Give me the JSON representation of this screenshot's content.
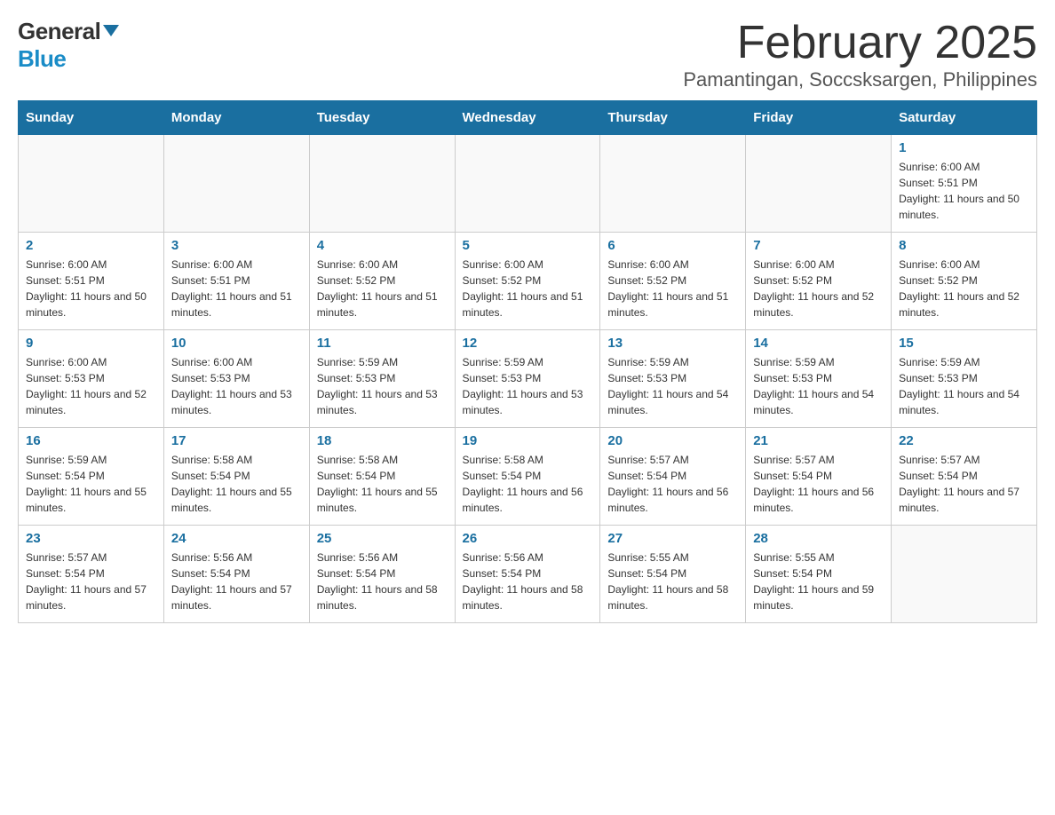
{
  "header": {
    "logo_general": "General",
    "logo_blue": "Blue",
    "title": "February 2025",
    "subtitle": "Pamantingan, Soccsksargen, Philippines"
  },
  "calendar": {
    "days_of_week": [
      "Sunday",
      "Monday",
      "Tuesday",
      "Wednesday",
      "Thursday",
      "Friday",
      "Saturday"
    ],
    "weeks": [
      [
        {
          "day": "",
          "info": ""
        },
        {
          "day": "",
          "info": ""
        },
        {
          "day": "",
          "info": ""
        },
        {
          "day": "",
          "info": ""
        },
        {
          "day": "",
          "info": ""
        },
        {
          "day": "",
          "info": ""
        },
        {
          "day": "1",
          "info": "Sunrise: 6:00 AM\nSunset: 5:51 PM\nDaylight: 11 hours and 50 minutes."
        }
      ],
      [
        {
          "day": "2",
          "info": "Sunrise: 6:00 AM\nSunset: 5:51 PM\nDaylight: 11 hours and 50 minutes."
        },
        {
          "day": "3",
          "info": "Sunrise: 6:00 AM\nSunset: 5:51 PM\nDaylight: 11 hours and 51 minutes."
        },
        {
          "day": "4",
          "info": "Sunrise: 6:00 AM\nSunset: 5:52 PM\nDaylight: 11 hours and 51 minutes."
        },
        {
          "day": "5",
          "info": "Sunrise: 6:00 AM\nSunset: 5:52 PM\nDaylight: 11 hours and 51 minutes."
        },
        {
          "day": "6",
          "info": "Sunrise: 6:00 AM\nSunset: 5:52 PM\nDaylight: 11 hours and 51 minutes."
        },
        {
          "day": "7",
          "info": "Sunrise: 6:00 AM\nSunset: 5:52 PM\nDaylight: 11 hours and 52 minutes."
        },
        {
          "day": "8",
          "info": "Sunrise: 6:00 AM\nSunset: 5:52 PM\nDaylight: 11 hours and 52 minutes."
        }
      ],
      [
        {
          "day": "9",
          "info": "Sunrise: 6:00 AM\nSunset: 5:53 PM\nDaylight: 11 hours and 52 minutes."
        },
        {
          "day": "10",
          "info": "Sunrise: 6:00 AM\nSunset: 5:53 PM\nDaylight: 11 hours and 53 minutes."
        },
        {
          "day": "11",
          "info": "Sunrise: 5:59 AM\nSunset: 5:53 PM\nDaylight: 11 hours and 53 minutes."
        },
        {
          "day": "12",
          "info": "Sunrise: 5:59 AM\nSunset: 5:53 PM\nDaylight: 11 hours and 53 minutes."
        },
        {
          "day": "13",
          "info": "Sunrise: 5:59 AM\nSunset: 5:53 PM\nDaylight: 11 hours and 54 minutes."
        },
        {
          "day": "14",
          "info": "Sunrise: 5:59 AM\nSunset: 5:53 PM\nDaylight: 11 hours and 54 minutes."
        },
        {
          "day": "15",
          "info": "Sunrise: 5:59 AM\nSunset: 5:53 PM\nDaylight: 11 hours and 54 minutes."
        }
      ],
      [
        {
          "day": "16",
          "info": "Sunrise: 5:59 AM\nSunset: 5:54 PM\nDaylight: 11 hours and 55 minutes."
        },
        {
          "day": "17",
          "info": "Sunrise: 5:58 AM\nSunset: 5:54 PM\nDaylight: 11 hours and 55 minutes."
        },
        {
          "day": "18",
          "info": "Sunrise: 5:58 AM\nSunset: 5:54 PM\nDaylight: 11 hours and 55 minutes."
        },
        {
          "day": "19",
          "info": "Sunrise: 5:58 AM\nSunset: 5:54 PM\nDaylight: 11 hours and 56 minutes."
        },
        {
          "day": "20",
          "info": "Sunrise: 5:57 AM\nSunset: 5:54 PM\nDaylight: 11 hours and 56 minutes."
        },
        {
          "day": "21",
          "info": "Sunrise: 5:57 AM\nSunset: 5:54 PM\nDaylight: 11 hours and 56 minutes."
        },
        {
          "day": "22",
          "info": "Sunrise: 5:57 AM\nSunset: 5:54 PM\nDaylight: 11 hours and 57 minutes."
        }
      ],
      [
        {
          "day": "23",
          "info": "Sunrise: 5:57 AM\nSunset: 5:54 PM\nDaylight: 11 hours and 57 minutes."
        },
        {
          "day": "24",
          "info": "Sunrise: 5:56 AM\nSunset: 5:54 PM\nDaylight: 11 hours and 57 minutes."
        },
        {
          "day": "25",
          "info": "Sunrise: 5:56 AM\nSunset: 5:54 PM\nDaylight: 11 hours and 58 minutes."
        },
        {
          "day": "26",
          "info": "Sunrise: 5:56 AM\nSunset: 5:54 PM\nDaylight: 11 hours and 58 minutes."
        },
        {
          "day": "27",
          "info": "Sunrise: 5:55 AM\nSunset: 5:54 PM\nDaylight: 11 hours and 58 minutes."
        },
        {
          "day": "28",
          "info": "Sunrise: 5:55 AM\nSunset: 5:54 PM\nDaylight: 11 hours and 59 minutes."
        },
        {
          "day": "",
          "info": ""
        }
      ]
    ]
  }
}
